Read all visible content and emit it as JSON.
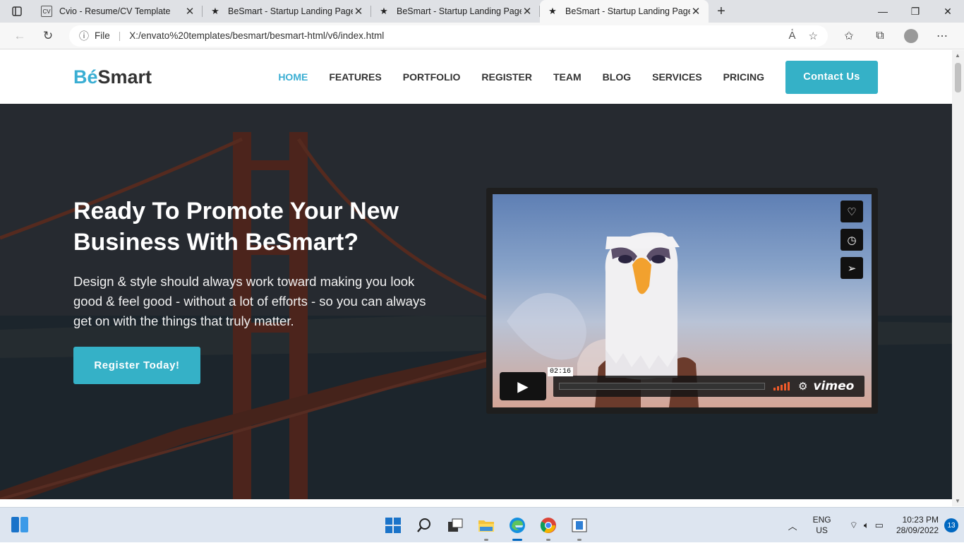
{
  "browser": {
    "tabs": [
      {
        "title": "Cvio - Resume/CV Template",
        "favicon": "CV"
      },
      {
        "title": "BeSmart - Startup Landing Page",
        "favicon": "★"
      },
      {
        "title": "BeSmart - Startup Landing Page",
        "favicon": "★"
      },
      {
        "title": "BeSmart - Startup Landing Page",
        "favicon": "★"
      }
    ],
    "active_tab": 3,
    "url_prefix": "File",
    "url": "X:/envato%20templates/besmart/besmart-html/v6/index.html"
  },
  "site": {
    "logo_be": "Bé",
    "logo_smart": "Smart",
    "nav": [
      "HOME",
      "FEATURES",
      "PORTFOLIO",
      "REGISTER",
      "TEAM",
      "BLOG",
      "SERVICES",
      "PRICING"
    ],
    "contact_label": "Contact Us",
    "hero": {
      "title": "Ready To Promote Your New Business With BeSmart?",
      "description": "Design & style should always work toward making you look good & feel good - without a lot of efforts - so you can always get on with the things that truly matter.",
      "cta": "Register Today!"
    },
    "video": {
      "time": "02:16",
      "brand": "vimeo"
    }
  },
  "taskbar": {
    "lang_line1": "ENG",
    "lang_line2": "US",
    "time": "10:23 PM",
    "date": "28/09/2022",
    "notifications": "13"
  }
}
